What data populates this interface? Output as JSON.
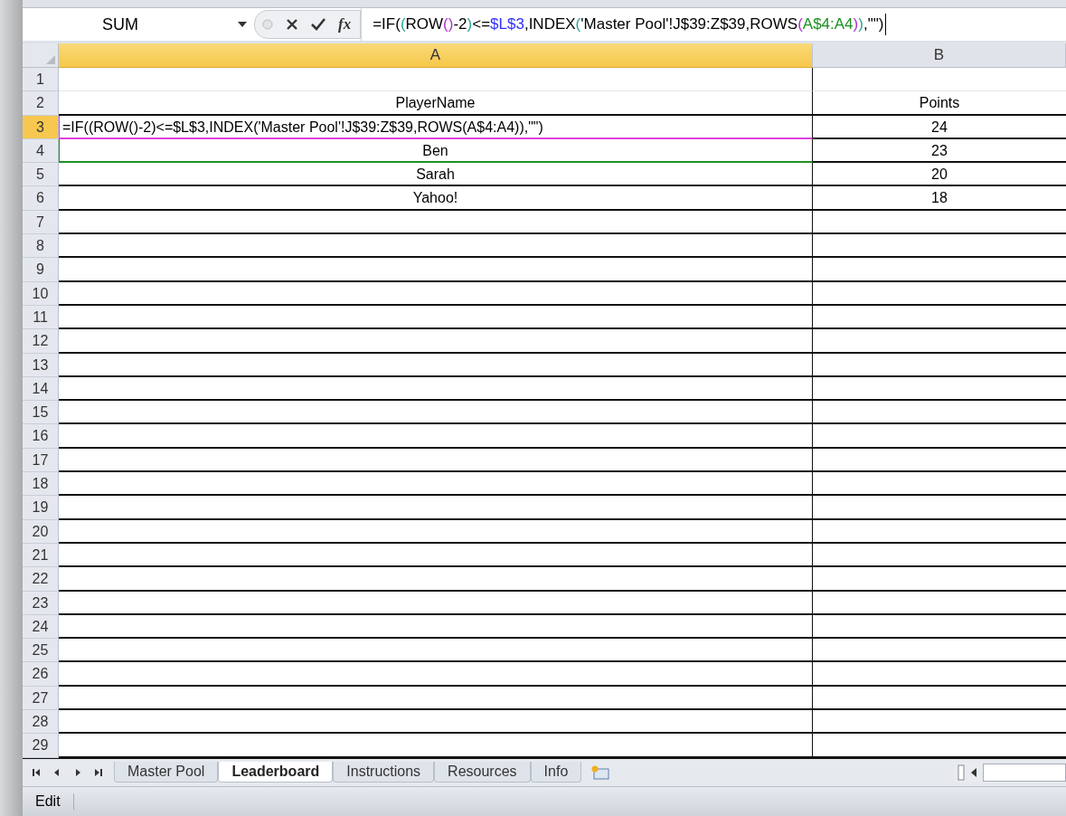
{
  "formula_bar": {
    "name_box": "SUM",
    "insert_function": "fx",
    "formula": [
      {
        "text": "=IF(",
        "color": "#000000"
      },
      {
        "text": "(",
        "color": "#2aa198"
      },
      {
        "text": "ROW",
        "color": "#000000"
      },
      {
        "text": "()",
        "color": "#b030d0"
      },
      {
        "text": "-2",
        "color": "#000000"
      },
      {
        "text": ")",
        "color": "#2aa198"
      },
      {
        "text": "<=",
        "color": "#000000"
      },
      {
        "text": "$L$3",
        "color": "#3030ff"
      },
      {
        "text": ",INDEX",
        "color": "#000000"
      },
      {
        "text": "(",
        "color": "#2aa198"
      },
      {
        "text": "'Master Pool'!J$39:Z$39,ROWS",
        "color": "#000000"
      },
      {
        "text": "(",
        "color": "#b030d0"
      },
      {
        "text": "A$4:A4",
        "color": "#1e9020"
      },
      {
        "text": ")",
        "color": "#b030d0"
      },
      {
        "text": ")",
        "color": "#2aa198"
      },
      {
        "text": ",\"\")",
        "color": "#000000"
      }
    ]
  },
  "columns": [
    {
      "label": "A",
      "selected": true
    },
    {
      "label": "B",
      "selected": false
    }
  ],
  "rows": [
    {
      "number": "1",
      "selected": false,
      "bordered": false,
      "cells": []
    },
    {
      "number": "2",
      "selected": false,
      "bordered": true,
      "cells": [
        "PlayerName",
        "Points"
      ]
    },
    {
      "number": "3",
      "selected": true,
      "bordered": true,
      "color": "#e040e0",
      "cells": [
        "=IF((ROW()-2)<=$L$3,INDEX('Master Pool'!J$39:Z$39,ROWS(A$4:A4)),\"\")",
        "24"
      ]
    },
    {
      "number": "4",
      "selected": false,
      "bordered": true,
      "color": "#1e9020",
      "cells": [
        "Ben",
        "23"
      ]
    },
    {
      "number": "5",
      "selected": false,
      "bordered": true,
      "cells": [
        "Sarah",
        "20"
      ]
    },
    {
      "number": "6",
      "selected": false,
      "bordered": true,
      "cells": [
        "Yahoo!",
        "18"
      ]
    },
    {
      "number": "7",
      "selected": false,
      "bordered": true,
      "cells": []
    },
    {
      "number": "8",
      "selected": false,
      "bordered": true,
      "cells": []
    },
    {
      "number": "9",
      "selected": false,
      "bordered": true,
      "cells": []
    },
    {
      "number": "10",
      "selected": false,
      "bordered": true,
      "cells": []
    },
    {
      "number": "11",
      "selected": false,
      "bordered": true,
      "cells": []
    },
    {
      "number": "12",
      "selected": false,
      "bordered": true,
      "cells": []
    },
    {
      "number": "13",
      "selected": false,
      "bordered": true,
      "cells": []
    },
    {
      "number": "14",
      "selected": false,
      "bordered": true,
      "cells": []
    },
    {
      "number": "15",
      "selected": false,
      "bordered": true,
      "cells": []
    },
    {
      "number": "16",
      "selected": false,
      "bordered": true,
      "cells": []
    },
    {
      "number": "17",
      "selected": false,
      "bordered": true,
      "cells": []
    },
    {
      "number": "18",
      "selected": false,
      "bordered": true,
      "cells": []
    },
    {
      "number": "19",
      "selected": false,
      "bordered": true,
      "cells": []
    },
    {
      "number": "20",
      "selected": false,
      "bordered": true,
      "cells": []
    },
    {
      "number": "21",
      "selected": false,
      "bordered": true,
      "cells": []
    },
    {
      "number": "22",
      "selected": false,
      "bordered": true,
      "cells": []
    },
    {
      "number": "23",
      "selected": false,
      "bordered": true,
      "cells": []
    },
    {
      "number": "24",
      "selected": false,
      "bordered": true,
      "cells": []
    },
    {
      "number": "25",
      "selected": false,
      "bordered": true,
      "cells": []
    },
    {
      "number": "26",
      "selected": false,
      "bordered": true,
      "cells": []
    },
    {
      "number": "27",
      "selected": false,
      "bordered": true,
      "cells": []
    },
    {
      "number": "28",
      "selected": false,
      "bordered": true,
      "cells": []
    },
    {
      "number": "29",
      "selected": false,
      "bordered": true,
      "cells": []
    }
  ],
  "sheet_tabs": [
    {
      "label": "Master Pool",
      "selected": false
    },
    {
      "label": "Leaderboard",
      "selected": true
    },
    {
      "label": "Instructions",
      "selected": false
    },
    {
      "label": "Resources",
      "selected": false
    },
    {
      "label": "Info",
      "selected": false
    }
  ],
  "status_bar": {
    "mode": "Edit"
  }
}
